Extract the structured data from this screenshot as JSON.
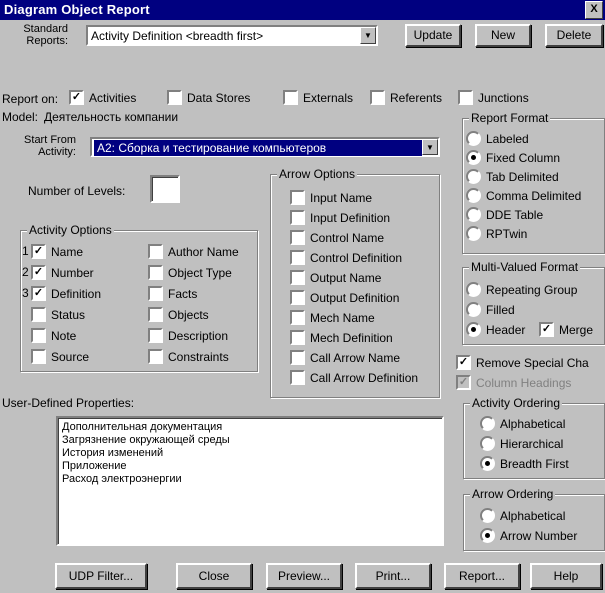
{
  "window": {
    "title": "Diagram Object Report",
    "close_glyph": "X"
  },
  "standard_reports": {
    "label": "Standard Reports:",
    "value": "Activity Definition <breadth first>"
  },
  "buttons": {
    "update": "Update",
    "new": "New",
    "delete": "Delete",
    "udp_filter": "UDP Filter...",
    "close": "Close",
    "preview": "Preview...",
    "print": "Print...",
    "report": "Report...",
    "help": "Help"
  },
  "report_on": {
    "label": "Report on:",
    "items": [
      {
        "label": "Activities",
        "checked": true
      },
      {
        "label": "Data Stores",
        "checked": false
      },
      {
        "label": "Externals",
        "checked": false
      },
      {
        "label": "Referents",
        "checked": false
      },
      {
        "label": "Junctions",
        "checked": false
      }
    ]
  },
  "model": {
    "label": "Model:",
    "value": "Деятельность компании"
  },
  "start_from": {
    "label": "Start From Activity:",
    "value": "A2: Сборка и тестирование компьютеров"
  },
  "levels": {
    "label": "Number of Levels:",
    "value": ""
  },
  "activity_options": {
    "title": "Activity Options",
    "left": [
      {
        "num": "1",
        "label": "Name",
        "checked": true
      },
      {
        "num": "2",
        "label": "Number",
        "checked": true
      },
      {
        "num": "3",
        "label": "Definition",
        "checked": true
      },
      {
        "num": "",
        "label": "Status",
        "checked": false
      },
      {
        "num": "",
        "label": "Note",
        "checked": false
      },
      {
        "num": "",
        "label": "Source",
        "checked": false
      }
    ],
    "right": [
      {
        "label": "Author Name",
        "checked": false
      },
      {
        "label": "Object Type",
        "checked": false
      },
      {
        "label": "Facts",
        "checked": false
      },
      {
        "label": "Objects",
        "checked": false
      },
      {
        "label": "Description",
        "checked": false
      },
      {
        "label": "Constraints",
        "checked": false
      }
    ]
  },
  "arrow_options": {
    "title": "Arrow Options",
    "items": [
      "Input Name",
      "Input Definition",
      "Control Name",
      "Control Definition",
      "Output Name",
      "Output Definition",
      "Mech Name",
      "Mech Definition",
      "Call Arrow Name",
      "Call Arrow Definition"
    ]
  },
  "report_format": {
    "title": "Report Format",
    "items": [
      {
        "label": "Labeled",
        "selected": false
      },
      {
        "label": "Fixed Column",
        "selected": true
      },
      {
        "label": "Tab Delimited",
        "selected": false
      },
      {
        "label": "Comma Delimited",
        "selected": false
      },
      {
        "label": "DDE Table",
        "selected": false
      },
      {
        "label": "RPTwin",
        "selected": false
      }
    ]
  },
  "multi_valued": {
    "title": "Multi-Valued Format",
    "items": [
      {
        "label": "Repeating Group",
        "selected": false
      },
      {
        "label": "Filled",
        "selected": false
      },
      {
        "label": "Header",
        "selected": true
      }
    ],
    "merge": {
      "label": "Merge",
      "checked": true
    }
  },
  "remove_special": {
    "label": "Remove Special Cha",
    "checked": true
  },
  "column_headings": {
    "label": "Column Headings",
    "checked": true,
    "disabled": true
  },
  "activity_ordering": {
    "title": "Activity Ordering",
    "items": [
      {
        "label": "Alphabetical",
        "selected": false
      },
      {
        "label": "Hierarchical",
        "selected": false
      },
      {
        "label": "Breadth First",
        "selected": true
      }
    ]
  },
  "arrow_ordering": {
    "title": "Arrow Ordering",
    "items": [
      {
        "label": "Alphabetical",
        "selected": false
      },
      {
        "label": "Arrow Number",
        "selected": true
      }
    ]
  },
  "udp": {
    "label": "User-Defined Properties:",
    "items": [
      "Дополнительная документация",
      "Загрязнение окружающей среды",
      "История изменений",
      "Приложение",
      "Расход электроэнергии"
    ]
  }
}
